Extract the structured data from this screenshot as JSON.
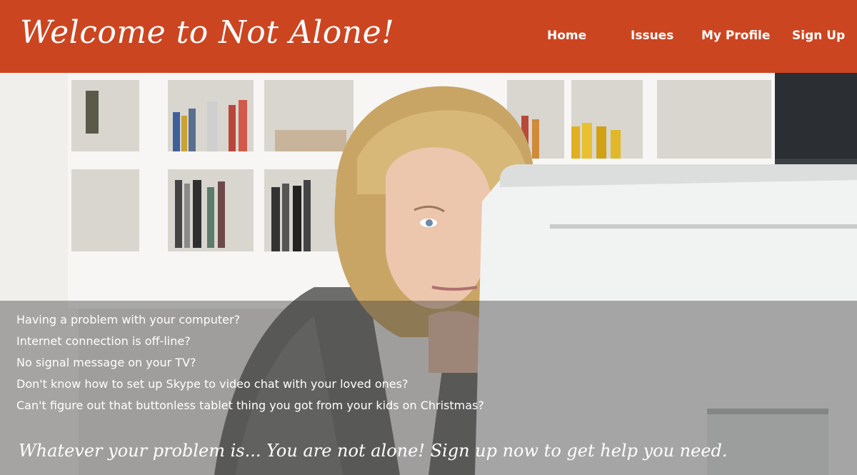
{
  "header": {
    "title": "Welcome to Not Alone!",
    "background_color": "#cc4521"
  },
  "nav": {
    "items": [
      {
        "label": "Home"
      },
      {
        "label": "Issues"
      },
      {
        "label": "My Profile"
      },
      {
        "label": "Sign Up"
      }
    ]
  },
  "hero": {
    "image_icon": "woman-at-computer-photo",
    "problems": [
      "Having a problem with your computer?",
      "Internet connection is off-line?",
      "No signal message on your TV?",
      "Don't know how to set up Skype to video chat with your loved ones?",
      "Can't figure out that buttonless tablet thing you got from your kids on Christmas?"
    ],
    "tagline": "Whatever your problem is... You are not alone! Sign up now to get help you need."
  }
}
